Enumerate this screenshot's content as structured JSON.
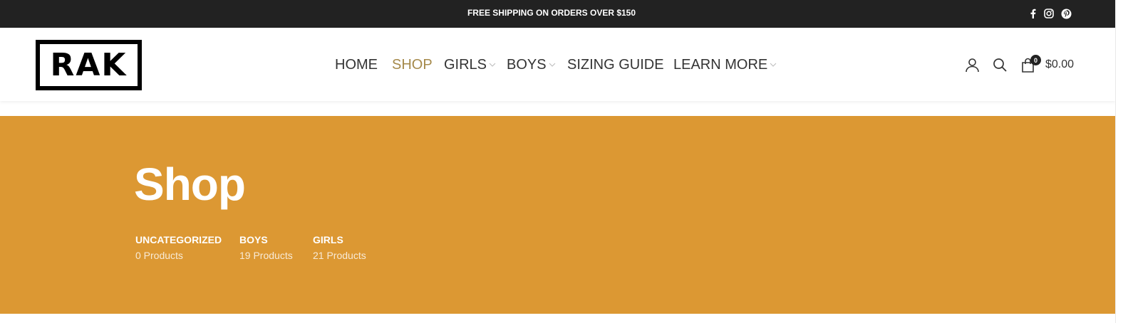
{
  "topbar": {
    "promo": "FREE SHIPPING ON ORDERS OVER $150",
    "social": [
      "facebook-icon",
      "instagram-icon",
      "pinterest-icon"
    ]
  },
  "header": {
    "logo": "RAK",
    "nav": [
      {
        "label": "HOME",
        "dropdown": false
      },
      {
        "label": "SHOP",
        "dropdown": false,
        "active": true
      },
      {
        "label": "GIRLS",
        "dropdown": true
      },
      {
        "label": "BOYS",
        "dropdown": true
      },
      {
        "label": "SIZING GUIDE",
        "dropdown": false
      },
      {
        "label": "LEARN MORE",
        "dropdown": true
      }
    ],
    "cart": {
      "count": "0",
      "total": "$0.00"
    },
    "icons": [
      "user-icon",
      "search-icon",
      "cart-icon"
    ]
  },
  "hero": {
    "title": "Shop",
    "categories": [
      {
        "name": "UNCATEGORIZED",
        "count": "0 Products"
      },
      {
        "name": "BOYS",
        "count": "19 Products"
      },
      {
        "name": "GIRLS",
        "count": "21 Products"
      }
    ]
  },
  "colors": {
    "topbar": "#222222",
    "accent": "#a5894a",
    "hero": "#dc9833"
  }
}
